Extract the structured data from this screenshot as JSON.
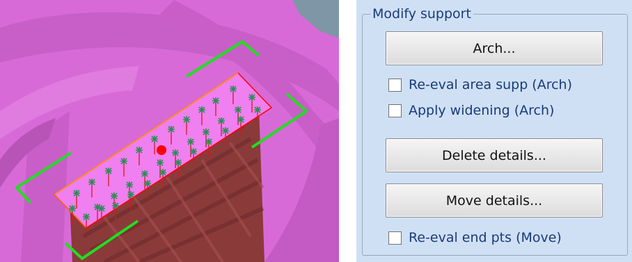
{
  "viewport": {
    "name": "3d-support-viewport",
    "selected_point_color": "#ff0000",
    "handle_color": "#22dd22",
    "model_color": "#d86ad8",
    "support_color": "#8b3a3a"
  },
  "panel": {
    "title": "Modify support",
    "arch_button": "Arch...",
    "reeval_area_label": "Re-eval area supp (Arch)",
    "apply_widening_label": "Apply widening (Arch)",
    "delete_details_button": "Delete details...",
    "move_details_button": "Move details...",
    "reeval_end_label": "Re-eval end pts (Move)"
  },
  "checkboxes": {
    "reeval_area": false,
    "apply_widening": false,
    "reeval_end": false
  }
}
